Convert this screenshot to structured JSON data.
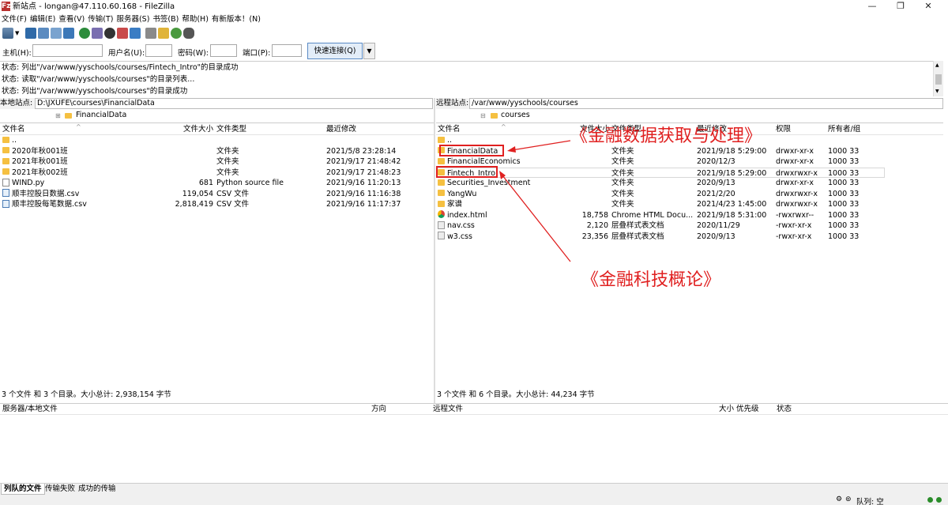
{
  "window": {
    "title": "新站点 - longan@47.110.60.168 - FileZilla",
    "app_icon": "Fz"
  },
  "menu": [
    "文件(F)",
    "编辑(E)",
    "查看(V)",
    "传输(T)",
    "服务器(S)",
    "书签(B)",
    "帮助(H)",
    "有新版本！(N)"
  ],
  "connect": {
    "host_label": "主机(H):",
    "host_value": "",
    "user_label": "用户名(U):",
    "user_value": "",
    "pass_label": "密码(W):",
    "pass_value": "",
    "port_label": "端口(P):",
    "port_value": "",
    "quickconnect": "快速连接(Q)"
  },
  "log": [
    "状态: 列出\"/var/www/yyschools/courses/Fintech_Intro\"的目录成功",
    "状态: 读取\"/var/www/yyschools/courses\"的目录列表...",
    "状态: 列出\"/var/www/yyschools/courses\"的目录成功"
  ],
  "local": {
    "site_label": "本地站点:",
    "path": "D:\\JXUFE\\courses\\FinancialData",
    "tree_node": "FinancialData",
    "headers": {
      "name": "文件名",
      "size": "文件大小",
      "type": "文件类型",
      "modified": "最近修改"
    },
    "rows": [
      {
        "name": "..",
        "size": "",
        "type": "",
        "modified": ""
      },
      {
        "name": "2020年秋001班",
        "size": "",
        "type": "文件夹",
        "modified": "2021/5/8 23:28:14"
      },
      {
        "name": "2021年秋001班",
        "size": "",
        "type": "文件夹",
        "modified": "2021/9/17 21:48:42"
      },
      {
        "name": "2021年秋002班",
        "size": "",
        "type": "文件夹",
        "modified": "2021/9/17 21:48:23"
      },
      {
        "name": "WIND.py",
        "size": "681",
        "type": "Python source file",
        "modified": "2021/9/16 11:20:13"
      },
      {
        "name": "顺丰控股日数据.csv",
        "size": "119,054",
        "type": "CSV 文件",
        "modified": "2021/9/16 11:16:38"
      },
      {
        "name": "顺丰控股每笔数据.csv",
        "size": "2,818,419",
        "type": "CSV 文件",
        "modified": "2021/9/16 11:17:37"
      }
    ],
    "status": "3 个文件 和 3 个目录。大小总计: 2,938,154 字节"
  },
  "remote": {
    "site_label": "远程站点:",
    "path": "/var/www/yyschools/courses",
    "tree_node": "courses",
    "headers": {
      "name": "文件名",
      "size": "文件大小",
      "type": "文件类型",
      "modified": "最近修改",
      "perms": "权限",
      "owner": "所有者/组"
    },
    "rows": [
      {
        "name": "..",
        "size": "",
        "type": "",
        "modified": "",
        "perms": "",
        "owner": ""
      },
      {
        "name": "FinancialData",
        "size": "",
        "type": "文件夹",
        "modified": "2021/9/18 5:29:00",
        "perms": "drwxr-xr-x",
        "owner": "1000 33"
      },
      {
        "name": "FinancialEconomics",
        "size": "",
        "type": "文件夹",
        "modified": "2020/12/3",
        "perms": "drwxr-xr-x",
        "owner": "1000 33"
      },
      {
        "name": "Fintech_Intro",
        "size": "",
        "type": "文件夹",
        "modified": "2021/9/18 5:29:00",
        "perms": "drwxrwxr-x",
        "owner": "1000 33"
      },
      {
        "name": "Securities_Investment",
        "size": "",
        "type": "文件夹",
        "modified": "2020/9/13",
        "perms": "drwxr-xr-x",
        "owner": "1000 33"
      },
      {
        "name": "YangWu",
        "size": "",
        "type": "文件夹",
        "modified": "2021/2/20",
        "perms": "drwxrwxr-x",
        "owner": "1000 33"
      },
      {
        "name": "家谱",
        "size": "",
        "type": "文件夹",
        "modified": "2021/4/23 1:45:00",
        "perms": "drwxrwxr-x",
        "owner": "1000 33"
      },
      {
        "name": "index.html",
        "size": "18,758",
        "type": "Chrome HTML Docu...",
        "modified": "2021/9/18 5:31:00",
        "perms": "-rwxrwxr--",
        "owner": "1000 33"
      },
      {
        "name": "nav.css",
        "size": "2,120",
        "type": "层叠样式表文档",
        "modified": "2020/11/29",
        "perms": "-rwxr-xr-x",
        "owner": "1000 33"
      },
      {
        "name": "w3.css",
        "size": "23,356",
        "type": "层叠样式表文档",
        "modified": "2020/9/13",
        "perms": "-rwxr-xr-x",
        "owner": "1000 33"
      }
    ],
    "status": "3 个文件 和 6 个目录。大小总计: 44,234 字节"
  },
  "queue": {
    "col_server": "服务器/本地文件",
    "col_direction": "方向",
    "col_remote": "远程文件",
    "col_size": "大小",
    "col_priority": "优先级",
    "col_status": "状态"
  },
  "tabs": [
    "列队的文件",
    "传输失败",
    "成功的传输"
  ],
  "statusbar": {
    "queue": "队列: 空"
  },
  "annotations": {
    "top": "《金融数据获取与处理》",
    "bottom": "《金融科技概论》",
    "color": "#e02020"
  }
}
